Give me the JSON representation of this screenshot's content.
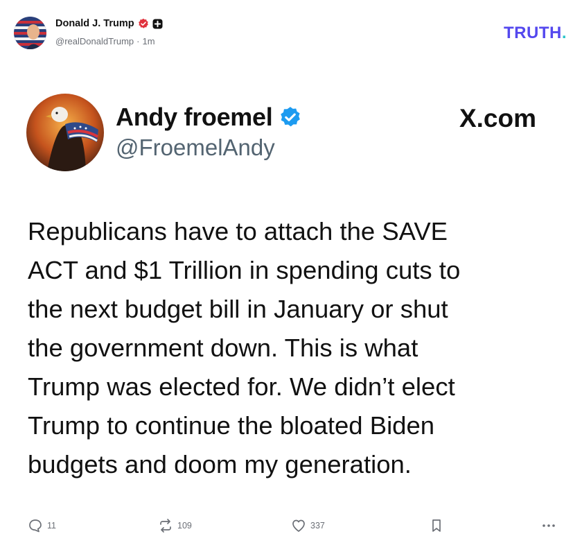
{
  "truth_post": {
    "author_name": "Donald J. Trump",
    "author_handle": "@realDonaldTrump",
    "separator": "·",
    "time_ago": "1m",
    "brand": "TRUTH",
    "brand_dot": "."
  },
  "embedded": {
    "author_name": "Andy froemel",
    "author_handle": "@FroemelAndy",
    "source": "X.com",
    "text": "Republicans have to attach the SAVE\nACT and $1 Trillion in spending cuts to\nthe next budget bill in January or shut\nthe government down. This is what\nTrump was elected for. We didn’t elect\nTrump to continue the bloated Biden\nbudgets and doom my generation."
  },
  "actions": {
    "replies": "11",
    "retruths": "109",
    "likes": "337"
  },
  "icons": {
    "verified_truth": "verified-badge-icon",
    "plus": "plus-badge-icon",
    "verified_x": "verified-badge-icon",
    "reply": "comment-icon",
    "retruth": "repost-icon",
    "like": "heart-icon",
    "bookmark": "bookmark-icon",
    "more": "more-dots-icon"
  },
  "colors": {
    "truth_brand": "#5448ee",
    "truth_dot": "#29c4c9",
    "verified_red": "#e0323d",
    "verified_blue": "#1d9bf0"
  }
}
